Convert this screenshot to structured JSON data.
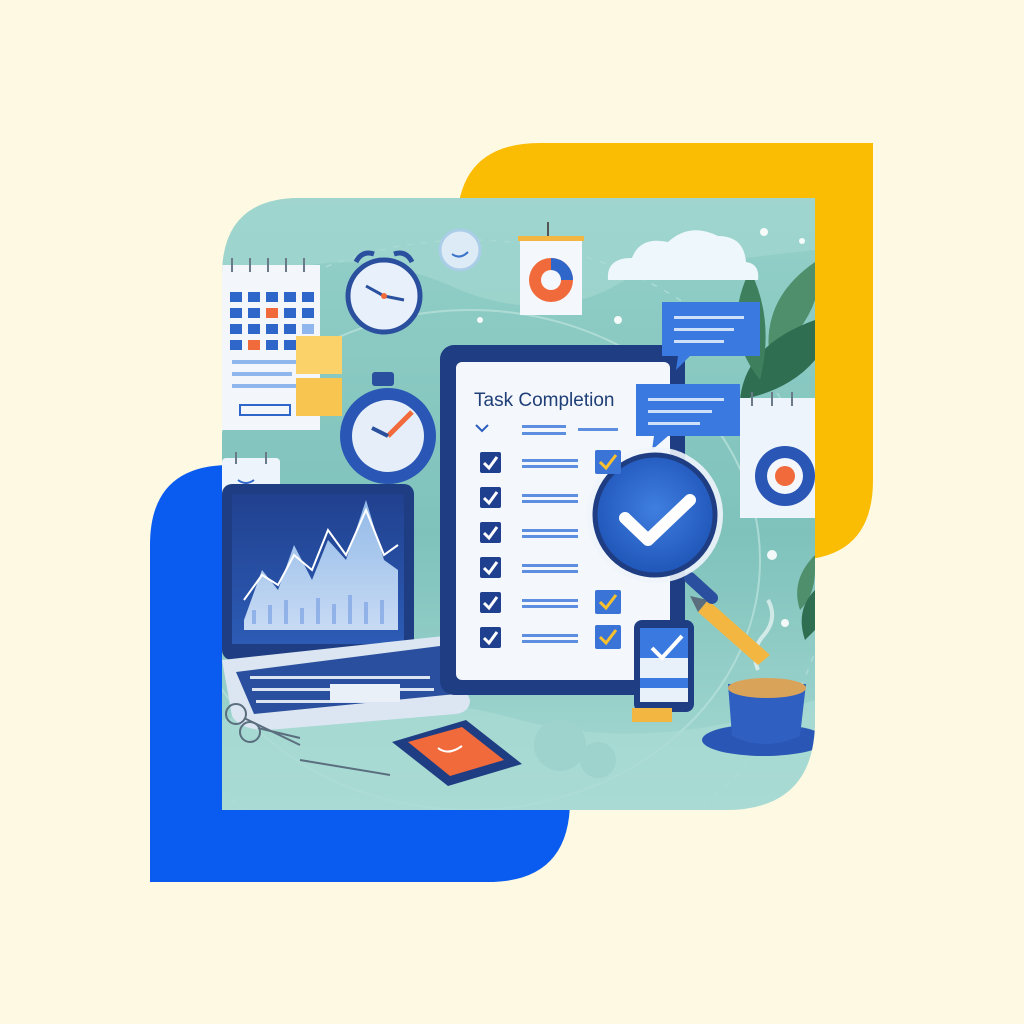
{
  "tablet": {
    "title": "Task Completion",
    "checklist": [
      {
        "checked": true,
        "highlight": true
      },
      {
        "checked": true,
        "highlight": false
      },
      {
        "checked": true,
        "highlight": false
      },
      {
        "checked": true,
        "highlight": false
      },
      {
        "checked": true,
        "highlight": true
      },
      {
        "checked": true,
        "highlight": true
      }
    ]
  },
  "icons": {
    "calendar": "calendar-icon",
    "alarm_clock": "alarm-clock-icon",
    "stopwatch": "stopwatch-icon",
    "pie_chart": "pie-chart-icon",
    "magnifier": "magnifier-check-icon",
    "coffee": "coffee-cup-icon",
    "phone": "smartphone-icon",
    "laptop": "laptop-icon",
    "chat": "chat-bubble-icon",
    "cloud": "cloud-icon"
  },
  "colors": {
    "background": "#fdf9e2",
    "yellow_accent": "#fbbc04",
    "blue_accent": "#0a5bf0",
    "teal_panel": "#8fcdc6",
    "navy": "#1e3f84",
    "check_blue": "#2a5dbf",
    "sticky_yellow": "#fbd16a",
    "orange": "#f06a3c"
  }
}
